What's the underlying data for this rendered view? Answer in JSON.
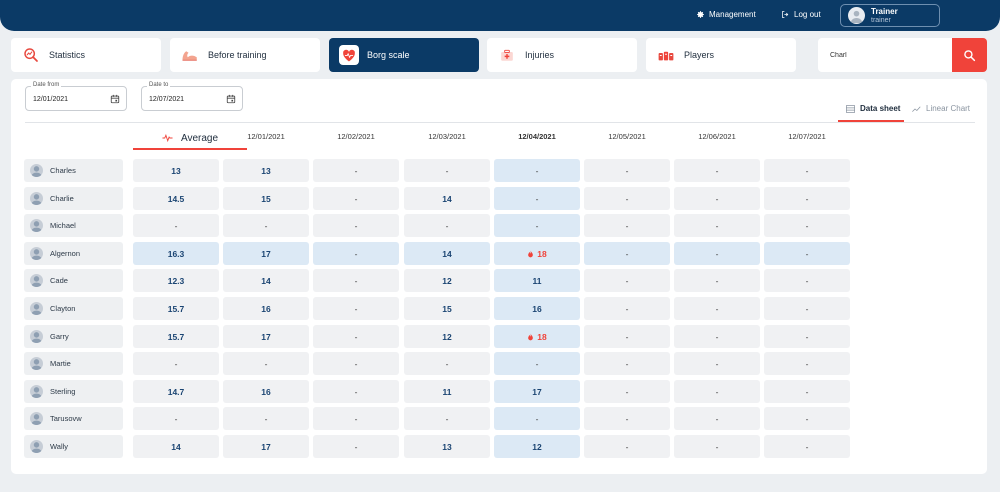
{
  "header": {
    "management_label": "Management",
    "logout_label": "Log out",
    "user_name": "Trainer",
    "user_role": "trainer"
  },
  "tabs": [
    {
      "label": "Statistics",
      "icon": "magnifier-chart-icon",
      "active": false
    },
    {
      "label": "Before training",
      "icon": "flexed-arm-icon",
      "active": false
    },
    {
      "label": "Borg scale",
      "icon": "heart-pulse-icon",
      "active": true
    },
    {
      "label": "Injuries",
      "icon": "first-aid-kit-icon",
      "active": false
    },
    {
      "label": "Players",
      "icon": "team-icon",
      "active": false
    }
  ],
  "search": {
    "value": "Charl"
  },
  "filters": {
    "date_from_label": "Date from",
    "date_from_value": "12/01/2021",
    "date_to_label": "Date to",
    "date_to_value": "12/07/2021"
  },
  "views": {
    "data_sheet": "Data sheet",
    "linear_chart": "Linear Chart",
    "active": "data_sheet"
  },
  "table": {
    "average_label": "Average",
    "dates": [
      "12/01/2021",
      "12/02/2021",
      "12/03/2021",
      "12/04/2021",
      "12/05/2021",
      "12/06/2021",
      "12/07/2021"
    ],
    "highlighted_date_index": 3,
    "rows": [
      {
        "player": "Charles",
        "average": "13",
        "values": [
          "13",
          "-",
          "-",
          "-",
          "-",
          "-",
          "-"
        ],
        "highlight": false,
        "fire": []
      },
      {
        "player": "Charlie",
        "average": "14.5",
        "values": [
          "15",
          "-",
          "14",
          "-",
          "-",
          "-",
          "-"
        ],
        "highlight": false,
        "fire": []
      },
      {
        "player": "Michael",
        "average": "-",
        "values": [
          "-",
          "-",
          "-",
          "-",
          "-",
          "-",
          "-"
        ],
        "highlight": false,
        "fire": []
      },
      {
        "player": "Algernon",
        "average": "16.3",
        "values": [
          "17",
          "-",
          "14",
          "18",
          "-",
          "-",
          "-"
        ],
        "highlight": true,
        "fire": [
          3
        ]
      },
      {
        "player": "Cade",
        "average": "12.3",
        "values": [
          "14",
          "-",
          "12",
          "11",
          "-",
          "-",
          "-"
        ],
        "highlight": false,
        "fire": []
      },
      {
        "player": "Clayton",
        "average": "15.7",
        "values": [
          "16",
          "-",
          "15",
          "16",
          "-",
          "-",
          "-"
        ],
        "highlight": false,
        "fire": []
      },
      {
        "player": "Garry",
        "average": "15.7",
        "values": [
          "17",
          "-",
          "12",
          "18",
          "-",
          "-",
          "-"
        ],
        "highlight": false,
        "fire": [
          3
        ]
      },
      {
        "player": "Martie",
        "average": "-",
        "values": [
          "-",
          "-",
          "-",
          "-",
          "-",
          "-",
          "-"
        ],
        "highlight": false,
        "fire": []
      },
      {
        "player": "Sterling",
        "average": "14.7",
        "values": [
          "16",
          "-",
          "11",
          "17",
          "-",
          "-",
          "-"
        ],
        "highlight": false,
        "fire": []
      },
      {
        "player": "Tarusovw",
        "average": "-",
        "values": [
          "-",
          "-",
          "-",
          "-",
          "-",
          "-",
          "-"
        ],
        "highlight": false,
        "fire": []
      },
      {
        "player": "Wally",
        "average": "14",
        "values": [
          "17",
          "-",
          "13",
          "12",
          "-",
          "-",
          "-"
        ],
        "highlight": false,
        "fire": []
      }
    ]
  },
  "colors": {
    "navy": "#0b3a66",
    "accent_red": "#f0433a",
    "highlight_blue": "#dce9f5",
    "value_blue": "#1a4472"
  }
}
